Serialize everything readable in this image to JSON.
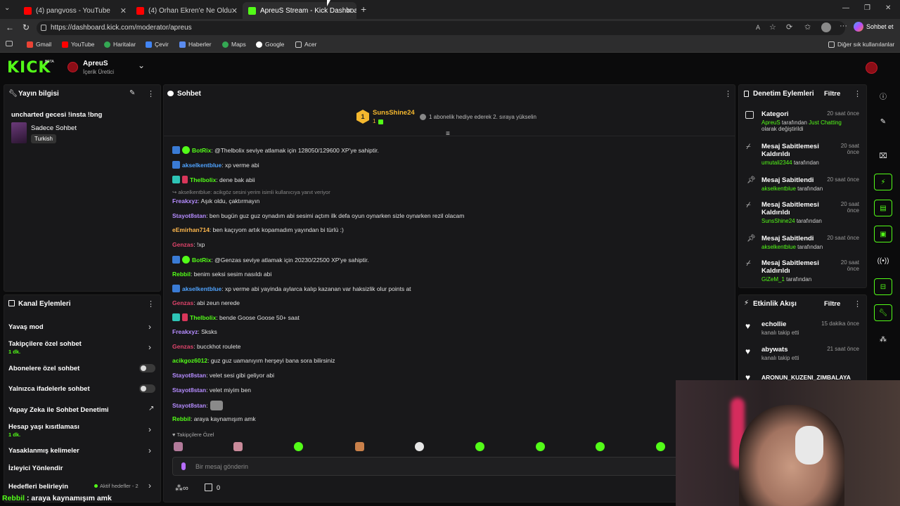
{
  "browser": {
    "tabs": [
      {
        "title": "(4) pangvoss - YouTube"
      },
      {
        "title": "(4) Orhan Ekren'e Ne Oldu? İngiltere"
      },
      {
        "title": "ApreuS Stream - Kick Dashboard"
      }
    ],
    "url": "https://dashboard.kick.com/moderator/apreus",
    "copilot_label": "Sohbet et",
    "bookmarks": [
      "Gmail",
      "YouTube",
      "Haritalar",
      "Çevir",
      "Haberler",
      "Maps",
      "Google",
      "Acer"
    ],
    "other_bookmarks": "Diğer sık kullanılanlar"
  },
  "header": {
    "logo": "KICK",
    "beta": "BETA",
    "channel_name": "ApreuS",
    "channel_role": "İçerik Üretici"
  },
  "stream_info": {
    "title": "Yayın bilgisi",
    "stream_title": "uncharted gecesi !insta !bng",
    "category": "Sadece Sohbet",
    "language": "Turkish"
  },
  "channel_actions": {
    "title": "Kanal Eylemleri",
    "items": [
      {
        "label": "Yavaş mod",
        "sub": ""
      },
      {
        "label": "Takipçilere özel sohbet",
        "sub": "1 dk."
      },
      {
        "label": "Abonelere özel sohbet",
        "sub": ""
      },
      {
        "label": "Yalnızca ifadelerle sohbet",
        "sub": ""
      },
      {
        "label": "Yapay Zeka ile Sohbet Denetimi",
        "sub": ""
      },
      {
        "label": "Hesap yaşı kısıtlaması",
        "sub": "1 dk."
      },
      {
        "label": "Yasaklanmış kelimeler",
        "sub": ""
      },
      {
        "label": "İzleyici Yönlendir",
        "sub": ""
      },
      {
        "label": "Hedefleri belirleyin",
        "sub": ""
      }
    ],
    "goals_status": "Aktif hedefler - 2"
  },
  "chat": {
    "title": "Sohbet",
    "pinned_user": "SunsShine24",
    "pinned_count": "1",
    "pinned_text": "1 abonelik hediye ederek 2. sıraya yükselin",
    "reply_note": "akselkentblue: acikgöz sesini yerim isimli kullanıcıya yanıt veriyor",
    "messages": [
      {
        "user": "BotRix",
        "text": ": @Thelbolix seviye atlamak için 128050/129600 XP'ye sahiptir.",
        "color": "#53fc18"
      },
      {
        "user": "akselkentblue",
        "text": ": xp verme abi",
        "color": "#4fa3ff"
      },
      {
        "user": "Thelbolix",
        "text": ": dene bak abii",
        "color": "#53fc18"
      },
      {
        "user": "Freakxyz",
        "text": ": Aşık oldu, çaktırmayın",
        "color": "#b58cff"
      },
      {
        "user": "Stayot8stan",
        "text": ": ben bugün guz guz oynadım abi sesimi açtım ilk defa oyun oynarken sizle oynarken rezil olacam",
        "color": "#b58cff"
      },
      {
        "user": "eEmirhan714",
        "text": ": ben kaçıyom artık kopamadım yayından bi türlü :)",
        "color": "#ffb84d"
      },
      {
        "user": "Genzas",
        "text": ": !xp",
        "color": "#e0446b"
      },
      {
        "user": "BotRix",
        "text": ": @Genzas seviye atlamak için 20230/22500 XP'ye sahiptir.",
        "color": "#53fc18"
      },
      {
        "user": "Rebbil",
        "text": ": benim seksi sesim nasıldı abi",
        "color": "#53fc18"
      },
      {
        "user": "akselkentblue",
        "text": ": xp verme abi yayinda aylarca kalıp kazanan var haksizlik olur points at",
        "color": "#4fa3ff"
      },
      {
        "user": "Genzas",
        "text": ": abi zeun nerede",
        "color": "#e0446b"
      },
      {
        "user": "Thelbolix",
        "text": ": bende Goose Goose 50+ saat",
        "color": "#53fc18"
      },
      {
        "user": "Freakxyz",
        "text": ": Sksks",
        "color": "#b58cff"
      },
      {
        "user": "Genzas",
        "text": ": bucckhot roulete",
        "color": "#e0446b"
      },
      {
        "user": "acikgoz6012",
        "text": ": guz guz uamanıyım herşeyi bana sora bilirsiniz",
        "color": "#53fc18"
      },
      {
        "user": "Stayot8stan",
        "text": ": velet sesi gibi geliyor abi",
        "color": "#b58cff"
      },
      {
        "user": "Stayot8stan",
        "text": ": velet miyim ben",
        "color": "#b58cff"
      },
      {
        "user": "Stayot8stan",
        "text": ":",
        "color": "#b58cff"
      },
      {
        "user": "Rebbil",
        "text": ": araya kaynamışım amk",
        "color": "#53fc18"
      }
    ],
    "followers_only": "Takipçilere Özel",
    "input_placeholder": "Bir mesaj gönderin",
    "points": "0"
  },
  "mod_actions": {
    "title": "Denetim Eylemleri",
    "filter": "Filtre",
    "items": [
      {
        "title": "Kategori",
        "time": "20 saat önce",
        "line1_user": "ApreuS",
        "line1_mid": " tarafından ",
        "line1_val": "Just Chatting",
        "line2": "olarak değiştirildi"
      },
      {
        "title": "Mesaj Sabitlemesi Kaldırıldı",
        "time": "20 saat önce",
        "user": "umutali2344",
        "suffix": " tarafından"
      },
      {
        "title": "Mesaj Sabitlendi",
        "time": "20 saat önce",
        "user": "akselkentblue",
        "suffix": " tarafından"
      },
      {
        "title": "Mesaj Sabitlemesi Kaldırıldı",
        "time": "20 saat önce",
        "user": "SunsShine24",
        "suffix": " tarafından"
      },
      {
        "title": "Mesaj Sabitlendi",
        "time": "20 saat önce",
        "user": "akselkentblue",
        "suffix": " tarafından"
      },
      {
        "title": "Mesaj Sabitlemesi Kaldırıldı",
        "time": "20 saat önce",
        "user": "GiZeM_1",
        "suffix": " tarafından"
      }
    ]
  },
  "activity": {
    "title": "Etkinlik Akışı",
    "filter": "Filtre",
    "items": [
      {
        "user": "echollie",
        "time": "15 dakika önce",
        "action": "kanalı takip etti"
      },
      {
        "user": "abywats",
        "time": "21 saat önce",
        "action": "kanalı takip etti"
      },
      {
        "user": "ARONUN_KUZENI_ZIMBALAYA",
        "time": "",
        "action": ""
      }
    ]
  },
  "overlay": {
    "user": "Rebbil",
    "text": " : araya kaynamışım amk"
  },
  "colors": {
    "kick_green": "#53fc18",
    "panel_bg": "#18181a",
    "page_bg": "#0b0b0c"
  }
}
